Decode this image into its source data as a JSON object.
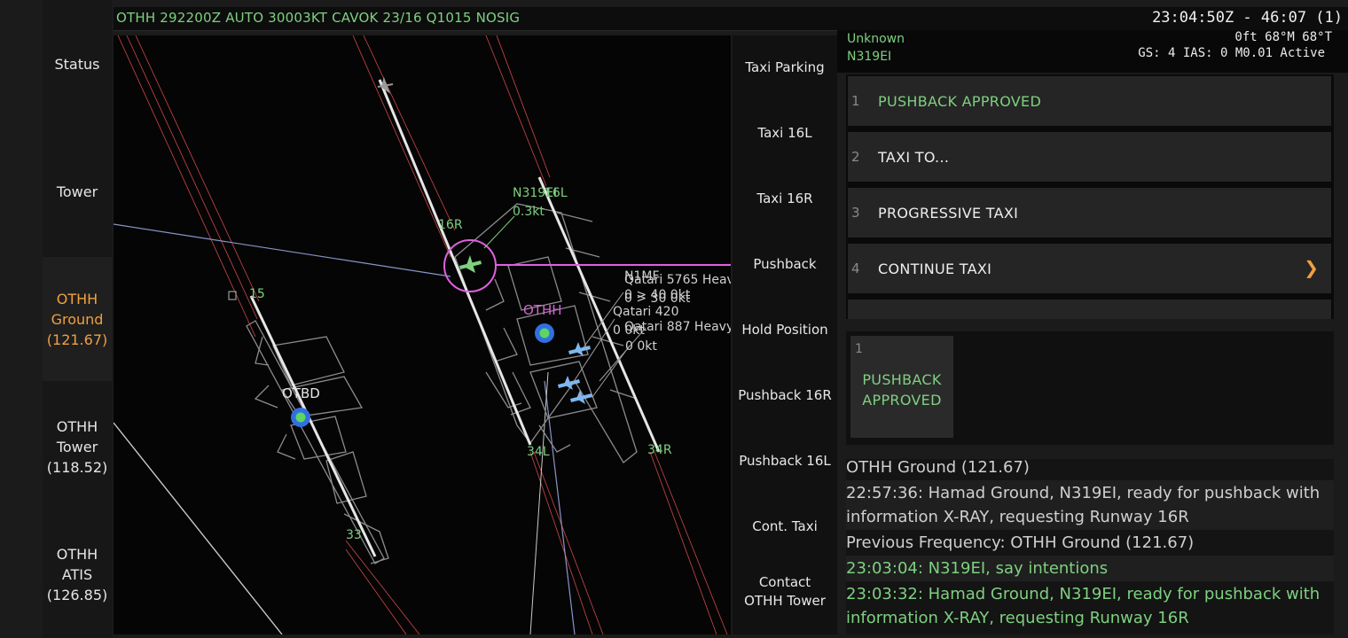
{
  "metar": "OTHH 292200Z AUTO 30003KT CAVOK 23/16 Q1015 NOSIG",
  "clock": "23:04:50Z - 46:07 (1)",
  "nav": [
    {
      "lines": [
        "Status"
      ],
      "active": false
    },
    {
      "lines": [
        "Tower"
      ],
      "active": false
    },
    {
      "lines": [
        "OTHH",
        "Ground",
        "(121.67)"
      ],
      "active": true
    },
    {
      "lines": [
        "OTHH",
        "Tower",
        "(118.52)"
      ],
      "active": false
    },
    {
      "lines": [
        "OTHH",
        "ATIS",
        "(126.85)"
      ],
      "active": false
    }
  ],
  "radar": {
    "runway_labels": [
      "16R",
      "16L",
      "34L",
      "34R",
      "15",
      "33"
    ],
    "airports": [
      "OTHH",
      "OTBD"
    ],
    "selected": {
      "callsign": "N319EI",
      "speed": "0.3kt"
    },
    "traffic": [
      {
        "callsign": "N1MF",
        "info": "0 > 40 0kt"
      },
      {
        "callsign": "Qatari 5765 Heavy",
        "info": "0 > 30 0kt"
      },
      {
        "callsign": "Qatari 420",
        "info": "0 0kt"
      },
      {
        "callsign": "Qatari 887 Heavy",
        "info": "0 0kt"
      }
    ]
  },
  "commands": [
    {
      "lines": [
        "Taxi Parking"
      ]
    },
    {
      "lines": [
        "Taxi 16L"
      ]
    },
    {
      "lines": [
        "Taxi 16R"
      ]
    },
    {
      "lines": [
        "Pushback"
      ]
    },
    {
      "lines": [
        "Hold Position"
      ]
    },
    {
      "lines": [
        "Pushback 16R"
      ]
    },
    {
      "lines": [
        "Pushback 16L"
      ]
    },
    {
      "lines": [
        "Cont. Taxi"
      ]
    },
    {
      "lines": [
        "Contact",
        "OTHH Tower"
      ]
    }
  ],
  "aircraft": {
    "type": "Unknown",
    "callsign": "N319EI",
    "altitude": "0ft 68°M 68°T",
    "speed": "GS: 4 IAS: 0 M0.01 Active"
  },
  "options": [
    {
      "num": "1",
      "label": "PUSHBACK APPROVED",
      "arrow": false
    },
    {
      "num": "2",
      "label": "TAXI TO...",
      "arrow": false
    },
    {
      "num": "3",
      "label": "PROGRESSIVE TAXI",
      "arrow": false
    },
    {
      "num": "4",
      "label": "CONTINUE TAXI",
      "arrow": true
    }
  ],
  "selected_option": {
    "num": "1",
    "lines": [
      "PUSHBACK",
      "APPROVED"
    ]
  },
  "log": [
    {
      "text": "OTHH Ground (121.67)",
      "green": false
    },
    {
      "text": "22:57:36: Hamad  Ground, N319EI, ready for pushback with information X-RAY, requesting Runway 16R",
      "green": false
    },
    {
      "text": "Previous Frequency: OTHH Ground (121.67)",
      "green": false
    },
    {
      "text": "23:03:04: N319EI, say intentions",
      "green": true
    },
    {
      "text": "23:03:32: Hamad  Ground, N319EI, ready for pushback with information X-RAY, requesting Runway 16R",
      "green": true
    }
  ],
  "colors": {
    "green": "#7ed080",
    "accent": "#f0a040",
    "magenta": "#e060e0",
    "runway": "#e6e6e6",
    "taxiway": "#8c8c8c",
    "approach": "#d04848",
    "traffic": "#7fb8f0",
    "airport": "#3070e0"
  },
  "icons": {
    "option_arrow": "chevron-right-icon",
    "aircraft": "plane-icon",
    "airport": "airport-marker-icon"
  }
}
